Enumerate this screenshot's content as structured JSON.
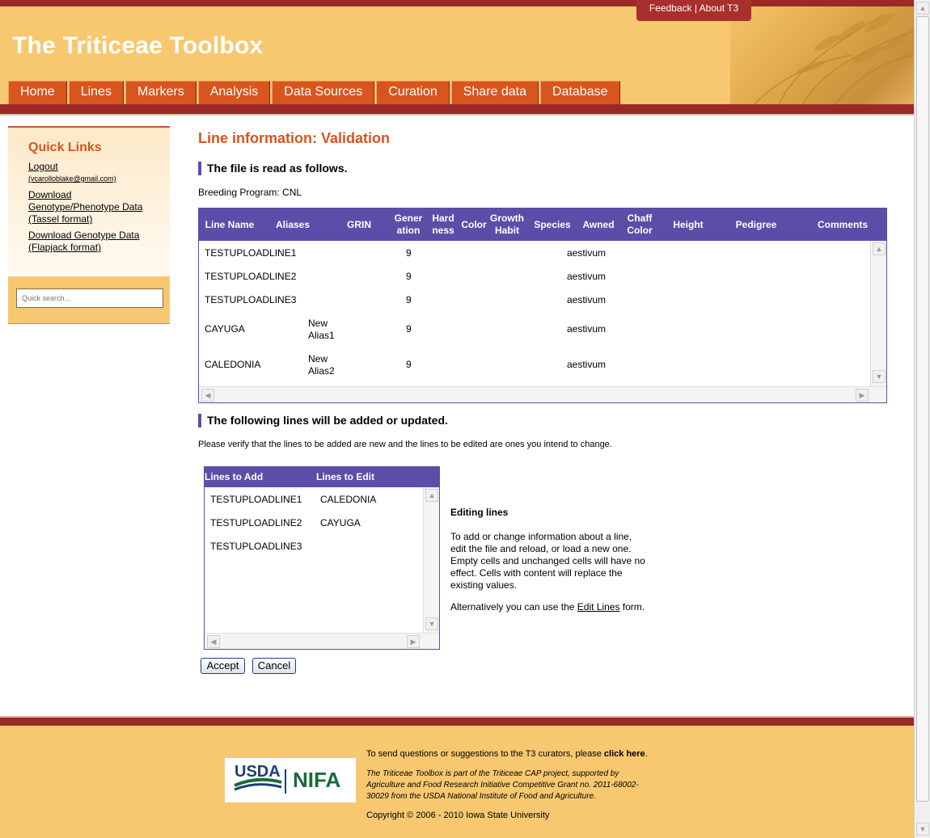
{
  "header": {
    "title": "The Triticeae Toolbox",
    "feedback_label": "Feedback",
    "about_label": "About T3",
    "separator": "|",
    "nav": [
      "Home",
      "Lines",
      "Markers",
      "Analysis",
      "Data Sources",
      "Curation",
      "Share data",
      "Database"
    ]
  },
  "sidebar": {
    "title": "Quick Links",
    "logout": "Logout",
    "email": "(vcarolloblake@gmail.com)",
    "download_tassel": [
      "Download",
      "Genotype/Phenotype Data",
      "(Tassel format)"
    ],
    "download_flapjack": [
      "Download Genotype Data",
      "(Flapjack format)"
    ],
    "search_placeholder": "Quick search..."
  },
  "main": {
    "title": "Line information: Validation",
    "section1": "The file is read as follows.",
    "breeding_program": "Breeding Program: CNL",
    "columns": [
      "Line Name",
      "Aliases",
      "GRIN",
      "Generation",
      "Hardness",
      "Color",
      "Growth Habit",
      "Species",
      "Awned",
      "Chaff Color",
      "Height",
      "Pedigree",
      "Comments"
    ],
    "column_display": {
      "line_name": "Line Name",
      "aliases": "Aliases",
      "grin": "GRIN",
      "generation": [
        "Gener",
        "ation"
      ],
      "hardness": [
        "Hard",
        "ness"
      ],
      "color": "Color",
      "growth_habit": [
        "Growth",
        "Habit"
      ],
      "species": "Species",
      "awned": "Awned",
      "chaff_color": [
        "Chaff",
        "Color"
      ],
      "height": "Height",
      "pedigree": "Pedigree",
      "comments": "Comments"
    },
    "rows": [
      {
        "line": "TESTUPLOADLINE1",
        "aliases": [
          "",
          ""
        ],
        "generation": "9",
        "species": "aestivum"
      },
      {
        "line": "TESTUPLOADLINE2",
        "aliases": [
          "",
          ""
        ],
        "generation": "9",
        "species": "aestivum"
      },
      {
        "line": "TESTUPLOADLINE3",
        "aliases": [
          "",
          ""
        ],
        "generation": "9",
        "species": "aestivum"
      },
      {
        "line": "CAYUGA",
        "aliases": [
          "New",
          "Alias1"
        ],
        "generation": "9",
        "species": "aestivum"
      },
      {
        "line": "CALEDONIA",
        "aliases": [
          "New",
          "Alias2"
        ],
        "generation": "9",
        "species": "aestivum"
      }
    ],
    "section2": "The following lines will be added or updated.",
    "verify_text": "Please verify that the lines to be added are new and the lines to be edited are ones you intend to change.",
    "lines_to_add_header": "Lines to Add",
    "lines_to_edit_header": "Lines to Edit",
    "lines_to_add": [
      "TESTUPLOADLINE1",
      "TESTUPLOADLINE2",
      "TESTUPLOADLINE3"
    ],
    "lines_to_edit": [
      "CALEDONIA",
      "CAYUGA"
    ],
    "editing_title": "Editing lines",
    "editing_text": [
      "To add or change information about a line,",
      "edit the file and reload, or load a new one.",
      "Empty cells and unchanged cells will have no",
      "effect. Cells with content will replace the",
      "existing values."
    ],
    "alt_prefix": "Alternatively you can use the ",
    "alt_link": "Edit Lines",
    "alt_suffix": " form.",
    "accept_label": "Accept",
    "cancel_label": "Cancel"
  },
  "footer": {
    "contact_prefix": "To send questions or suggestions to the T3 curators, please ",
    "contact_link": "click here",
    "contact_suffix": ".",
    "funding": [
      "The Triticeae Toolbox is part of the Triticeae CAP project, supported by",
      "Agriculture and Food Research Initiative Competitive Grant no. 2011-68002-",
      "30029 from the USDA National Institute of Food and Agriculture."
    ],
    "copyright": "Copyright © 2006 - 2010 Iowa State University",
    "logo_usda": "USDA",
    "logo_nifa": "NIFA"
  },
  "colors": {
    "header_bg": "#f7c870",
    "dark_red": "#9b2a27",
    "nav_orange": "#d9551e",
    "table_purple": "#5b4ea8",
    "title_orange": "#d9541e"
  }
}
